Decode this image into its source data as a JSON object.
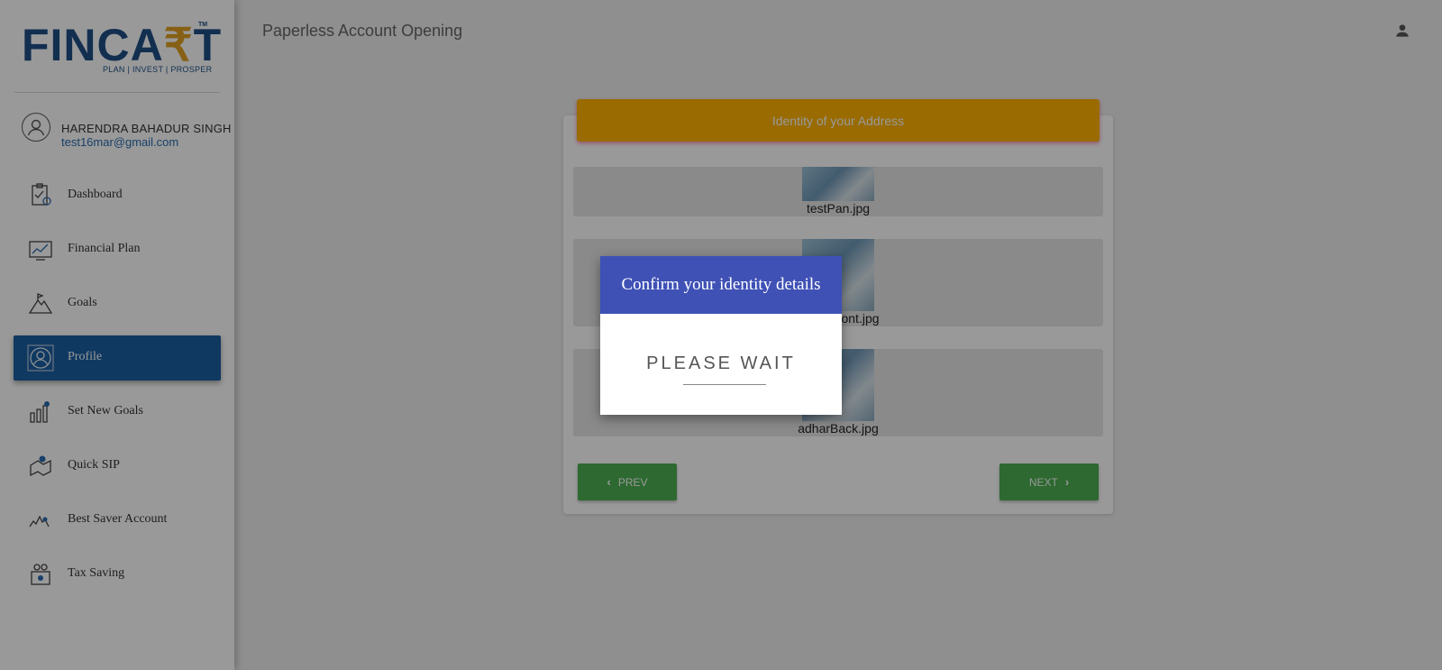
{
  "brand": {
    "logo_main": "FINCA",
    "logo_rupee": "₹",
    "logo_end": "T",
    "trademark": "TM",
    "tagline": "PLAN | INVEST | PROSPER"
  },
  "user": {
    "name": "HARENDRA BAHADUR SINGH",
    "email": "test16mar@gmail.com"
  },
  "sidebar": {
    "items": [
      {
        "label": "Dashboard",
        "icon": "dashboard-icon"
      },
      {
        "label": "Financial Plan",
        "icon": "chart-icon"
      },
      {
        "label": "Goals",
        "icon": "mountain-icon"
      },
      {
        "label": "Profile",
        "icon": "profile-icon",
        "active": true
      },
      {
        "label": "Set New Goals",
        "icon": "goals-icon"
      },
      {
        "label": "Quick SIP",
        "icon": "sip-icon"
      },
      {
        "label": "Best Saver Account",
        "icon": "saver-icon"
      },
      {
        "label": "Tax Saving",
        "icon": "tax-icon"
      }
    ]
  },
  "header": {
    "title": "Paperless Account Opening",
    "account_icon": "account-icon"
  },
  "card": {
    "title": "Identity of your Address",
    "documents": [
      {
        "filename": "testPan.jpg"
      },
      {
        "filename": "adharFront.jpg"
      },
      {
        "filename": "adharBack.jpg"
      }
    ],
    "prev_label": "PREV",
    "next_label": "NEXT"
  },
  "modal": {
    "title": "Confirm your identity details",
    "status": "PLEASE WAIT"
  },
  "colors": {
    "primary": "#1b5fa3",
    "header_bar": "#ffb300",
    "modal_head": "#3f51b5",
    "button": "#4caf50"
  }
}
